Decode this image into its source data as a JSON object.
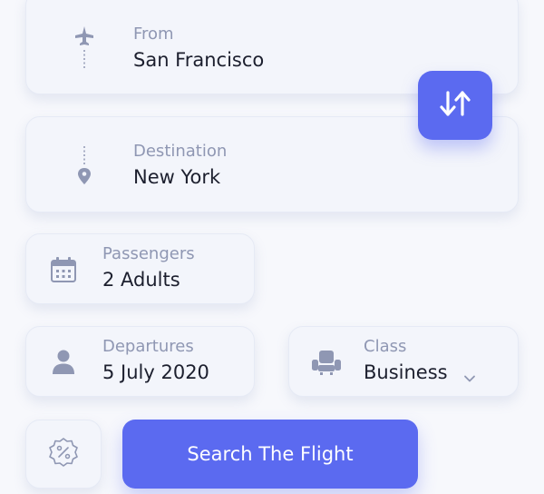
{
  "from": {
    "label": "From",
    "value": "San Francisco",
    "icon": "plane-icon"
  },
  "destination": {
    "label": "Destination",
    "value": "New York",
    "icon": "location-pin-icon"
  },
  "swap": {
    "icon": "swap-arrows-icon"
  },
  "passengers": {
    "label": "Passengers",
    "value": "2 Adults",
    "icon": "calendar-icon"
  },
  "departures": {
    "label": "Departures",
    "value": "5 July 2020",
    "icon": "person-icon"
  },
  "class": {
    "label": "Class",
    "value": "Business",
    "icon": "seat-icon",
    "dropdown_icon": "chevron-down-icon"
  },
  "promo": {
    "icon": "discount-badge-icon"
  },
  "search": {
    "label": "Search The Flight"
  },
  "colors": {
    "accent": "#5b6af0",
    "label_text": "#8f97b3",
    "value_text": "#1c1f2e",
    "icon": "#8f97b3"
  }
}
